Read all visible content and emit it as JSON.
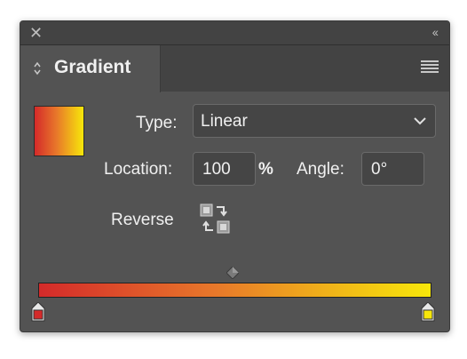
{
  "panel": {
    "close_glyph": "✕",
    "collapse_glyph": "‹‹",
    "tab_title": "Gradient",
    "menu_icon": "hamburger-menu-icon"
  },
  "gradient": {
    "type_label": "Type:",
    "type_value": "Linear",
    "location_label": "Location:",
    "location_value": "100",
    "location_unit": "%",
    "angle_label": "Angle:",
    "angle_value": "0°",
    "reverse_label": "Reverse",
    "start_color": "#d42a2a",
    "end_color": "#f7e70a"
  },
  "colors": {
    "panel_bg": "#535353",
    "titlebar_bg": "#434343"
  }
}
